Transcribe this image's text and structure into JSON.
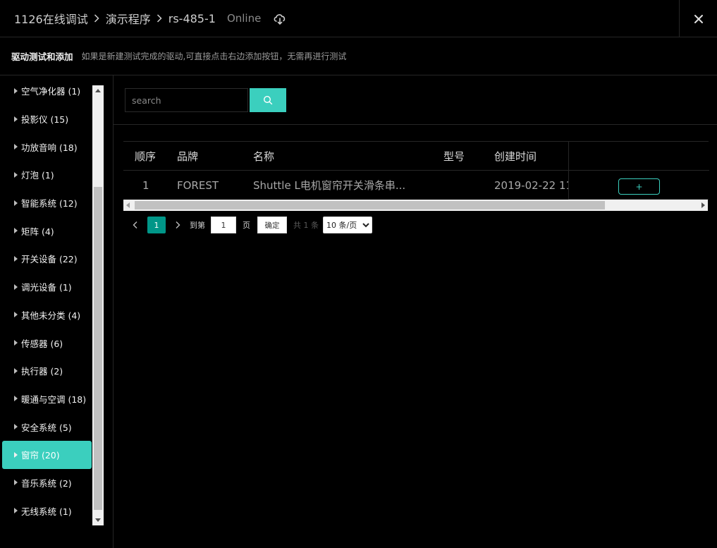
{
  "header": {
    "breadcrumbs": [
      "1126在线调试",
      "演示程序",
      "rs-485-1"
    ],
    "status": "Online"
  },
  "subheader": {
    "title": "驱动测试和添加",
    "hint": "如果是新建测试完成的驱动,可直接点击右边添加按钮，无需再进行测试"
  },
  "sidebar": {
    "items": [
      {
        "label": "空气净化器 (1)",
        "active": false
      },
      {
        "label": "投影仪 (15)",
        "active": false
      },
      {
        "label": "功放音响 (18)",
        "active": false
      },
      {
        "label": "灯泡 (1)",
        "active": false
      },
      {
        "label": "智能系统 (12)",
        "active": false
      },
      {
        "label": "矩阵 (4)",
        "active": false
      },
      {
        "label": "开关设备 (22)",
        "active": false
      },
      {
        "label": "调光设备 (1)",
        "active": false
      },
      {
        "label": "其他未分类 (4)",
        "active": false
      },
      {
        "label": "传感器 (6)",
        "active": false
      },
      {
        "label": "执行器 (2)",
        "active": false
      },
      {
        "label": "暖通与空调 (18)",
        "active": false
      },
      {
        "label": "安全系统 (5)",
        "active": false
      },
      {
        "label": "窗帘 (20)",
        "active": true
      },
      {
        "label": "音乐系统 (2)",
        "active": false
      },
      {
        "label": "无线系统 (1)",
        "active": false
      }
    ]
  },
  "search": {
    "placeholder": "search",
    "value": ""
  },
  "table": {
    "columns": [
      "顺序",
      "品牌",
      "名称",
      "型号",
      "创建时间"
    ],
    "rows": [
      {
        "index": "1",
        "brand": "FOREST",
        "name": "Shuttle L电机窗帘开关滑条串...",
        "model": "",
        "created": "2019-02-22 11:",
        "action": "+"
      }
    ]
  },
  "pagination": {
    "current_page": "1",
    "goto_label": "到第",
    "goto_value": "1",
    "page_label": "页",
    "confirm_label": "确定",
    "total_label": "共 1 条",
    "page_size_options": [
      "10 条/页"
    ],
    "page_size_selected": "10 条/页"
  },
  "colors": {
    "accent": "#3bcfbe",
    "page_active": "#009688",
    "background": "#000000"
  },
  "icons": {
    "cloud": "cloud-sync-icon",
    "close": "close-icon",
    "search": "search-icon",
    "caret": "caret-right-icon"
  }
}
